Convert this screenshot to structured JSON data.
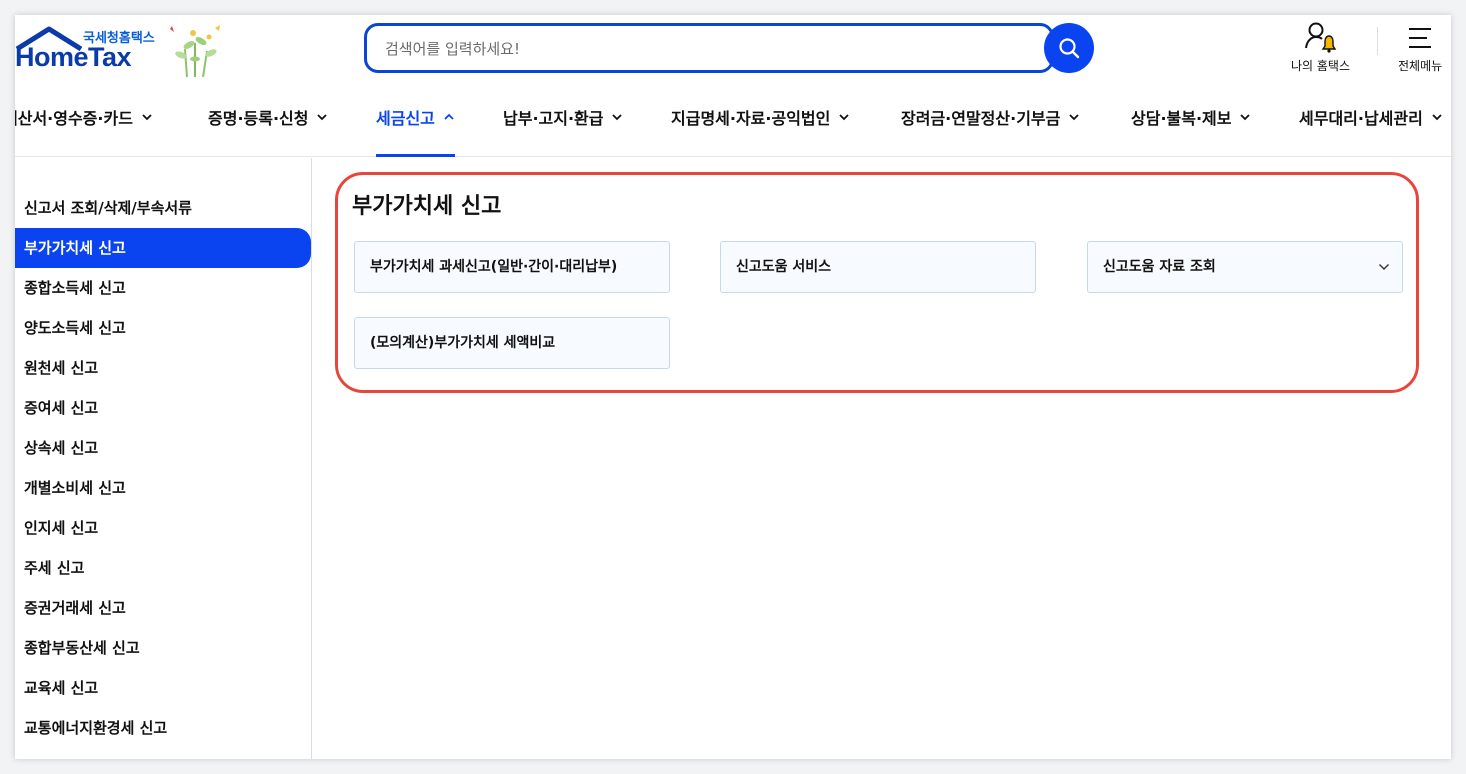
{
  "header": {
    "logo_sub": "국세청홈택스",
    "logo_main": "HomeTax",
    "search_placeholder": "검색어를 입력하세요!",
    "my_hometax_label": "나의 홈택스",
    "all_menu_label": "전체메뉴"
  },
  "gnb": {
    "items": [
      {
        "label": "계산서·영수증·카드",
        "active": false
      },
      {
        "label": "증명·등록·신청",
        "active": false
      },
      {
        "label": "세금신고",
        "active": true
      },
      {
        "label": "납부·고지·환급",
        "active": false
      },
      {
        "label": "지급명세·자료·공익법인",
        "active": false
      },
      {
        "label": "장려금·연말정산·기부금",
        "active": false
      },
      {
        "label": "상담·불복·제보",
        "active": false
      },
      {
        "label": "세무대리·납세관리",
        "active": false
      }
    ]
  },
  "sidebar": {
    "items": [
      {
        "label": "신고서 조회/삭제/부속서류",
        "active": false
      },
      {
        "label": "부가가치세 신고",
        "active": true
      },
      {
        "label": "종합소득세 신고",
        "active": false
      },
      {
        "label": "양도소득세 신고",
        "active": false
      },
      {
        "label": "원천세 신고",
        "active": false
      },
      {
        "label": "증여세 신고",
        "active": false
      },
      {
        "label": "상속세 신고",
        "active": false
      },
      {
        "label": "개별소비세 신고",
        "active": false
      },
      {
        "label": "인지세 신고",
        "active": false
      },
      {
        "label": "주세 신고",
        "active": false
      },
      {
        "label": "증권거래세 신고",
        "active": false
      },
      {
        "label": "종합부동산세 신고",
        "active": false
      },
      {
        "label": "교육세 신고",
        "active": false
      },
      {
        "label": "교통에너지환경세 신고",
        "active": false
      }
    ]
  },
  "content": {
    "title": "부가가치세 신고",
    "cards": [
      {
        "label": "부가가치세 과세신고(일반·간이·대리납부)"
      },
      {
        "label": "신고도움 서비스"
      },
      {
        "label": "신고도움 자료 조회",
        "icon": "chevron-down-icon"
      },
      {
        "label": "(모의계산)부가가치세 세액비교"
      }
    ]
  },
  "colors": {
    "brand_blue": "#0a44f0",
    "highlight_red": "#e8453c",
    "card_border": "#c7d8ee"
  }
}
